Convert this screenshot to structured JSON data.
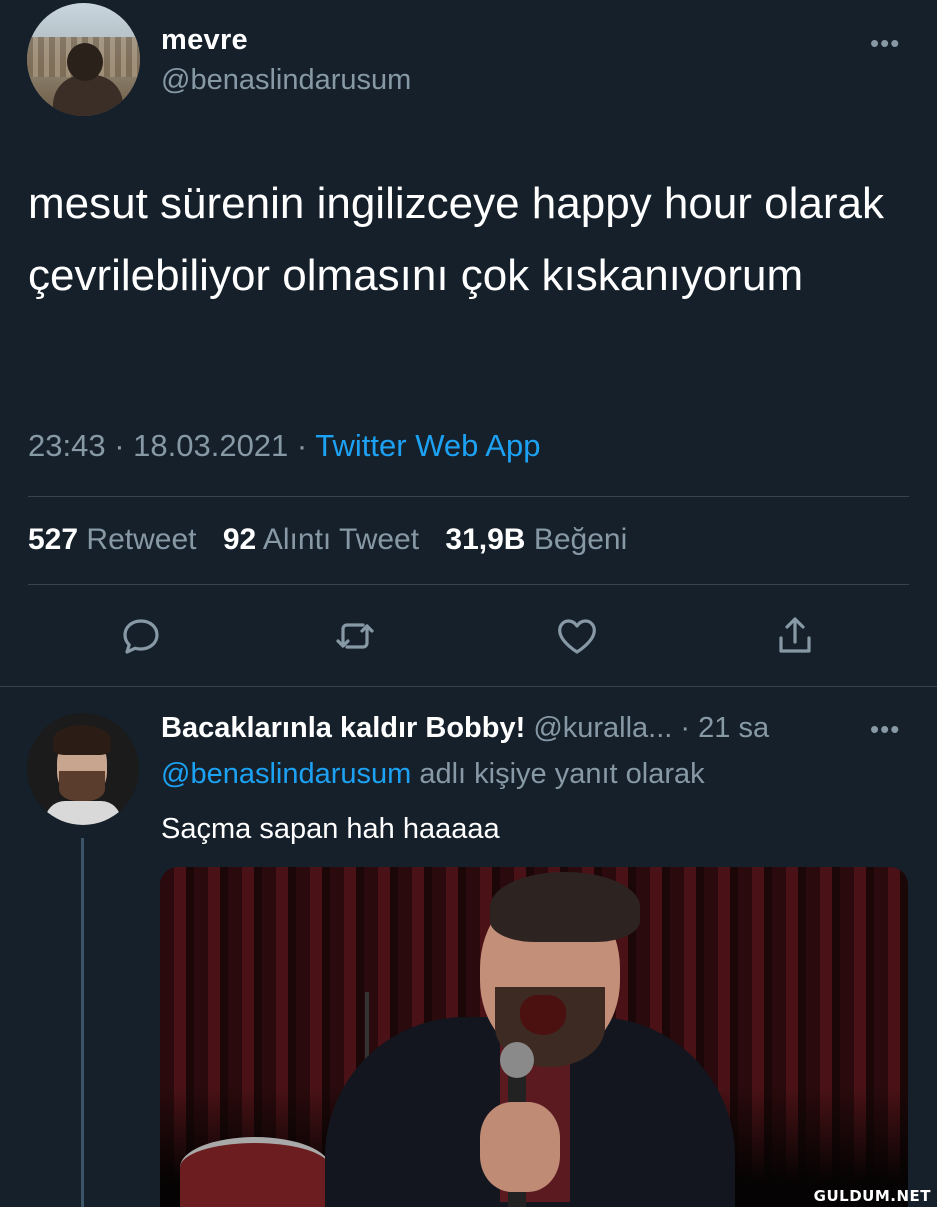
{
  "tweet": {
    "author": {
      "name": "mevre",
      "handle": "@benaslindarusum"
    },
    "more_label": "•••",
    "text": "mesut sürenin ingilizceye happy hour olarak çevrilebiliyor olmasını çok kıskanıyorum",
    "time": "23:43",
    "date": "18.03.2021",
    "separator": " · ",
    "source": "Twitter Web App",
    "stats": {
      "retweets_count": "527",
      "retweets_label": "Retweet",
      "quotes_count": "92",
      "quotes_label": "Alıntı Tweet",
      "likes_count": "31,9B",
      "likes_label": "Beğeni"
    },
    "actions": [
      "reply-icon",
      "retweet-icon",
      "like-icon",
      "share-icon"
    ]
  },
  "reply": {
    "name": "Bacaklarınla kaldır Bobby!",
    "handle": "@kuralla...",
    "time": "· 21 sa",
    "more_label": "•••",
    "replying_to_mention": "@benaslindarusum",
    "replying_to_suffix": "adlı kişiye yanıt olarak",
    "text": "Saçma sapan hah haaaaa"
  },
  "watermark": "GULDUM.NET",
  "colors": {
    "background": "#15202b",
    "text": "#ffffff",
    "secondary": "#8899a6",
    "accent": "#1da1f2",
    "divider": "#38444d"
  }
}
